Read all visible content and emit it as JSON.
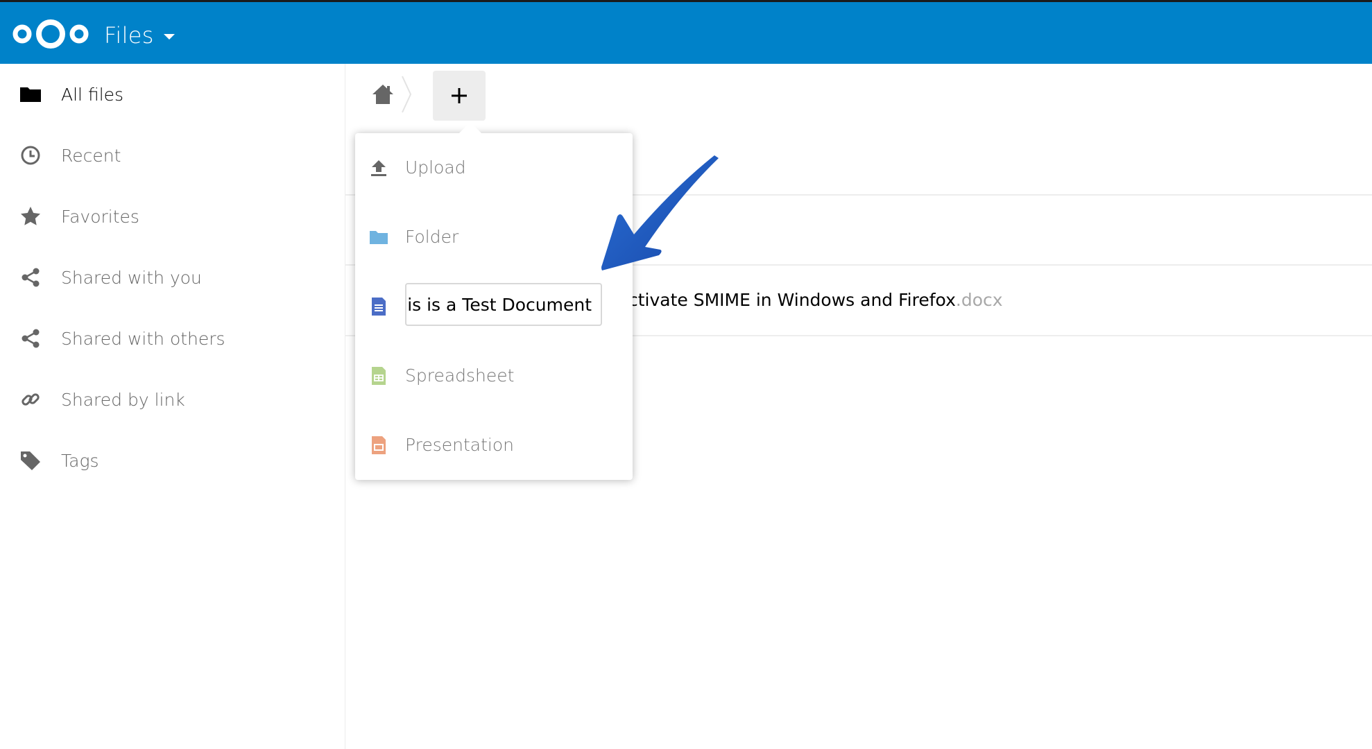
{
  "header": {
    "app_title": "Files",
    "background_color": "#0082c9",
    "logo_icon": "nextcloud-logo"
  },
  "sidebar": {
    "items": [
      {
        "label": "All files",
        "icon": "folder-icon",
        "active": true
      },
      {
        "label": "Recent",
        "icon": "clock-icon"
      },
      {
        "label": "Favorites",
        "icon": "star-icon"
      },
      {
        "label": "Shared with you",
        "icon": "share-icon"
      },
      {
        "label": "Shared with others",
        "icon": "share-icon"
      },
      {
        "label": "Shared by link",
        "icon": "link-icon"
      },
      {
        "label": "Tags",
        "icon": "tag-icon"
      }
    ]
  },
  "toolbar": {
    "home_icon": "home-icon",
    "new_button_icon": "plus-icon"
  },
  "new_menu": {
    "items": [
      {
        "label": "Upload",
        "icon": "upload-icon"
      },
      {
        "label": "Folder",
        "icon": "folder-icon",
        "color": "#6fb3e0"
      },
      {
        "label": "",
        "icon": "document-icon",
        "color": "#4b6dc6",
        "input_value": "ıis is a Test Document"
      },
      {
        "label": "Spreadsheet",
        "icon": "spreadsheet-icon",
        "color": "#b5d48e"
      },
      {
        "label": "Presentation",
        "icon": "presentation-icon",
        "color": "#eda27f"
      }
    ]
  },
  "files": [
    {
      "name": "ctivate SMIME in Windows and Firefox",
      "ext": ".docx"
    }
  ],
  "annotation": {
    "arrow_color": "#1f5fbf"
  }
}
